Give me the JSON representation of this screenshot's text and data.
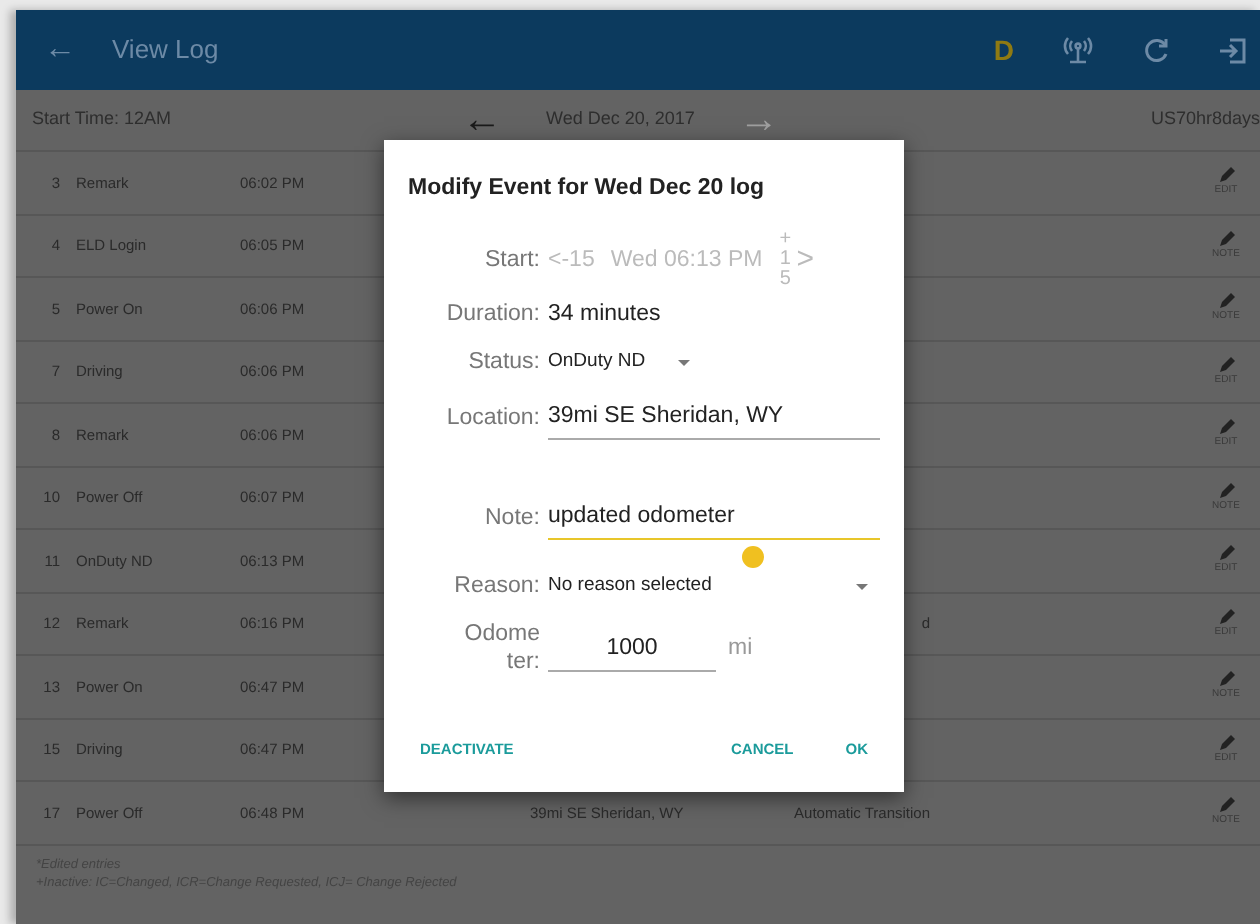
{
  "app_bar": {
    "back": "←",
    "title": "View Log",
    "driver_badge": "D"
  },
  "log_header": {
    "start_time": "Start Time: 12AM",
    "prev": "←",
    "date": "Wed Dec 20, 2017",
    "next": "→",
    "next_disabled": true,
    "rule": "US70hr8days"
  },
  "events": [
    {
      "number": "3",
      "event": "Remark",
      "time": "06:02 PM",
      "action": "EDIT"
    },
    {
      "number": "4",
      "event": "ELD Login",
      "time": "06:05 PM",
      "action": "NOTE"
    },
    {
      "number": "5",
      "event": "Power On",
      "time": "06:06 PM",
      "action": "NOTE"
    },
    {
      "number": "7",
      "event": "Driving",
      "time": "06:06 PM",
      "action": "EDIT"
    },
    {
      "number": "8",
      "event": "Remark",
      "time": "06:06 PM",
      "action": "EDIT"
    },
    {
      "number": "10",
      "event": "Power Off",
      "time": "06:07 PM",
      "action": "NOTE"
    },
    {
      "number": "11",
      "event": "OnDuty ND",
      "time": "06:13 PM",
      "action": "EDIT"
    },
    {
      "number": "12",
      "event": "Remark",
      "time": "06:16 PM",
      "origin": "d",
      "action": "EDIT"
    },
    {
      "number": "13",
      "event": "Power On",
      "time": "06:47 PM",
      "action": "NOTE"
    },
    {
      "number": "15",
      "event": "Driving",
      "time": "06:47 PM",
      "action": "EDIT"
    },
    {
      "number": "17",
      "event": "Power Off",
      "time": "06:48 PM",
      "location": "39mi SE Sheridan, WY",
      "origin": "Automatic Transition",
      "action": "NOTE"
    }
  ],
  "legend": [
    "*Edited entries",
    "+Inactive: IC=Changed, ICR=Change Requested, ICJ= Change Rejected"
  ],
  "dialog": {
    "title": "Modify Event for Wed Dec 20 log",
    "start": {
      "label": "Start:",
      "minus": "<-15",
      "value": "Wed 06:13 PM",
      "plus": "+15",
      "next": ">",
      "disabled": true
    },
    "duration": {
      "label": "Duration:",
      "value": "34 minutes"
    },
    "status": {
      "label": "Status:",
      "value": "OnDuty ND"
    },
    "location": {
      "label": "Location:",
      "value": "39mi SE Sheridan, WY",
      "focused": false
    },
    "note": {
      "label": "Note:",
      "value": "updated odometer",
      "focused": true
    },
    "reason": {
      "label": "Reason:",
      "value": "No reason selected"
    },
    "odometer": {
      "label": "Odometer:",
      "value": "1000",
      "unit": "mi"
    },
    "buttons": [
      {
        "label": "DEACTIVATE",
        "kind": "left"
      },
      {
        "label": "CANCEL",
        "kind": "right"
      },
      {
        "label": "OK",
        "kind": "right"
      }
    ]
  }
}
